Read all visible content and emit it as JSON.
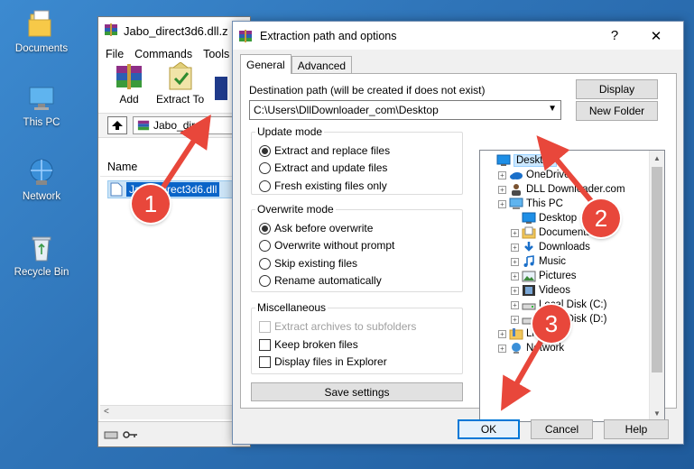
{
  "desktop": {
    "icons": [
      {
        "label": "Documents",
        "icon": "folder-documents-icon"
      },
      {
        "label": "This PC",
        "icon": "computer-icon"
      },
      {
        "label": "Network",
        "icon": "network-icon"
      },
      {
        "label": "Recycle Bin",
        "icon": "recycle-bin-icon"
      }
    ]
  },
  "winrar": {
    "title": "Jabo_direct3d6.dll.z",
    "menu": [
      "File",
      "Commands",
      "Tools"
    ],
    "toolbar": {
      "add": "Add",
      "extract_to": "Extract To"
    },
    "address": "Jabo_direc",
    "list_header": "Name",
    "file": "Jabo_direct3d6.dll"
  },
  "dialog": {
    "title": "Extraction path and options",
    "help": "?",
    "close": "✕",
    "tabs": [
      "General",
      "Advanced"
    ],
    "dest_label": "Destination path (will be created if does not exist)",
    "dest_value": "C:\\Users\\DllDownloader_com\\Desktop",
    "display_btn": "Display",
    "new_folder_btn": "New Folder",
    "update_mode": {
      "title": "Update mode",
      "options": [
        "Extract and replace files",
        "Extract and update files",
        "Fresh existing files only"
      ]
    },
    "overwrite_mode": {
      "title": "Overwrite mode",
      "options": [
        "Ask before overwrite",
        "Overwrite without prompt",
        "Skip existing files",
        "Rename automatically"
      ]
    },
    "misc": {
      "title": "Miscellaneous",
      "options": [
        "Extract archives to subfolders",
        "Keep broken files",
        "Display files in Explorer"
      ]
    },
    "save_settings": "Save settings",
    "tree": [
      {
        "label": "Desktop",
        "icon": "desktop-icon"
      },
      {
        "label": "OneDrive",
        "icon": "onedrive-icon"
      },
      {
        "label": "DLL Downloader.com",
        "icon": "user-icon"
      },
      {
        "label": "This PC",
        "icon": "computer-icon"
      },
      {
        "label": "Desktop",
        "icon": "desktop-icon"
      },
      {
        "label": "Documents",
        "icon": "documents-icon"
      },
      {
        "label": "Downloads",
        "icon": "downloads-icon"
      },
      {
        "label": "Music",
        "icon": "music-icon"
      },
      {
        "label": "Pictures",
        "icon": "pictures-icon"
      },
      {
        "label": "Videos",
        "icon": "videos-icon"
      },
      {
        "label": "Local Disk (C:)",
        "icon": "drive-icon"
      },
      {
        "label": "Local Disk (D:)",
        "icon": "drive-icon"
      },
      {
        "label": "Libraries",
        "icon": "library-icon"
      },
      {
        "label": "Network",
        "icon": "network-icon"
      }
    ],
    "ok": "OK",
    "cancel": "Cancel",
    "help_btn": "Help"
  },
  "annotations": [
    "1",
    "2",
    "3"
  ],
  "colors": {
    "annotation": "#e8473b",
    "desktop": "#2f74b8",
    "accent": "#0078d7"
  }
}
